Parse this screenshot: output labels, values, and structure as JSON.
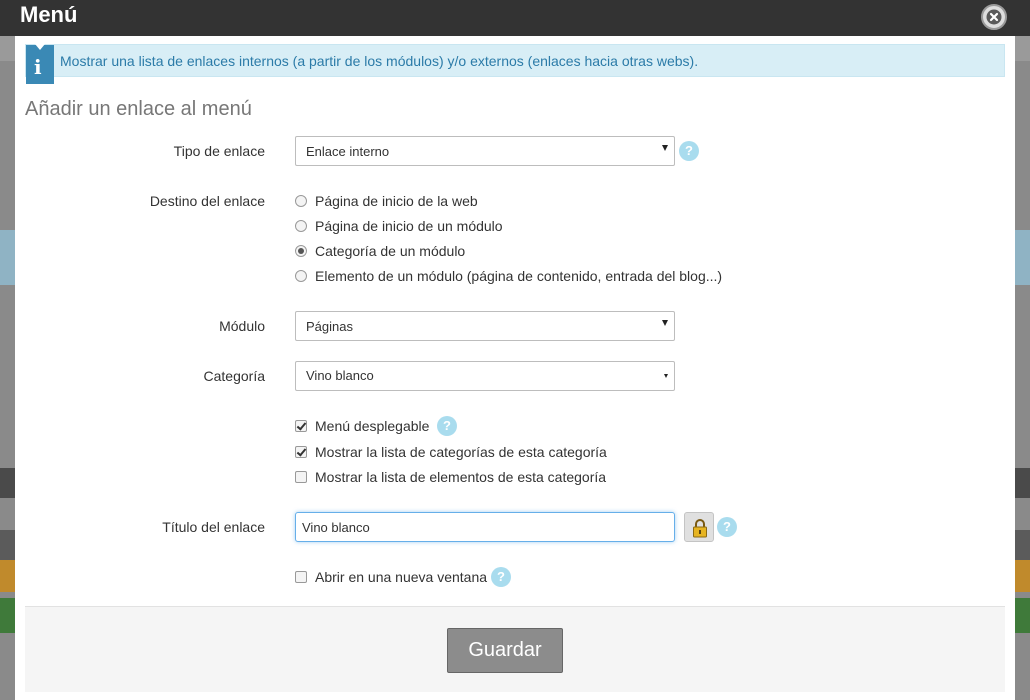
{
  "modal": {
    "title": "Menú"
  },
  "info": {
    "text": "Mostrar una lista de enlaces internos (a partir de los módulos) y/o externos (enlaces hacia otras webs)."
  },
  "form": {
    "section_title": "Añadir un enlace al menú",
    "link_type": {
      "label": "Tipo de enlace",
      "value": "Enlace interno"
    },
    "destination": {
      "label": "Destino del enlace",
      "options": [
        {
          "label": "Página de inicio de la web",
          "checked": false
        },
        {
          "label": "Página de inicio de un módulo",
          "checked": false
        },
        {
          "label": "Categoría de un módulo",
          "checked": true
        },
        {
          "label": "Elemento de un módulo (página de contenido, entrada del blog...)",
          "checked": false
        }
      ]
    },
    "module": {
      "label": "Módulo",
      "value": "Páginas"
    },
    "category": {
      "label": "Categoría",
      "value": "Vino blanco"
    },
    "checkboxes": [
      {
        "label": "Menú desplegable",
        "checked": true
      },
      {
        "label": "Mostrar la lista de categorías de esta categoría",
        "checked": true
      },
      {
        "label": "Mostrar la lista de elementos de esta categoría",
        "checked": false
      }
    ],
    "link_title": {
      "label": "Título del enlace",
      "value": "Vino blanco"
    },
    "new_window": {
      "label": "Abrir en una nueva ventana",
      "checked": false
    },
    "help_glyph": "?"
  },
  "footer": {
    "save_label": "Guardar"
  },
  "colors": {
    "header": "#333333",
    "info_bg": "#d8eef6",
    "info_text": "#2b7ba8",
    "help_icon": "#a9dcee",
    "save_button": "#8c8c8c"
  }
}
